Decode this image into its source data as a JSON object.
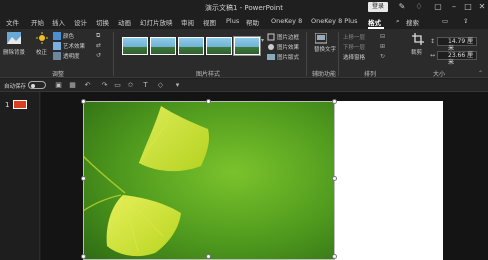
{
  "titlebar": {
    "title": "演示文稿1 - PowerPoint",
    "login_label": "登录",
    "icons": [
      "pen-icon",
      "lightbulb-icon",
      "restore-icon",
      "minimize-icon",
      "maximize-icon",
      "close-icon"
    ]
  },
  "tabs": [
    {
      "label": "文件"
    },
    {
      "label": "开始"
    },
    {
      "label": "插入"
    },
    {
      "label": "设计"
    },
    {
      "label": "切换"
    },
    {
      "label": "动画"
    },
    {
      "label": "幻灯片放映"
    },
    {
      "label": "审阅"
    },
    {
      "label": "视图"
    },
    {
      "label": "Plus"
    },
    {
      "label": "帮助"
    },
    {
      "label": "OneKey 8"
    },
    {
      "label": "OneKey 8 Plus"
    },
    {
      "label": "格式",
      "active": true
    },
    {
      "label": "搜索"
    }
  ],
  "ribbon": {
    "adjust": {
      "remove_bg": "删除背景",
      "corrections": "校正",
      "color": "颜色",
      "artistic": "艺术效果",
      "transparency": "透明度",
      "label": "调整"
    },
    "picture_styles": {
      "border": "图片边框",
      "effects": "图片效果",
      "layout": "图片版式",
      "label": "图片样式"
    },
    "accessibility": {
      "alt_text": "替换文字",
      "label": "辅助功能"
    },
    "arrange": {
      "bring_forward": "上移一层",
      "send_backward": "下移一层",
      "selection_pane": "选择窗格",
      "label": "排列"
    },
    "crop": {
      "label": "裁剪"
    },
    "size": {
      "height": "14.79 厘米",
      "width": "23.66 厘米",
      "label": "大小"
    }
  },
  "qat": {
    "autosave": "自动保存",
    "autosave_state": "关"
  },
  "slides": {
    "current": "1"
  },
  "colors": {
    "accent": "#d94020",
    "leaf": "#c9e030",
    "background_green": "#5aa020"
  }
}
